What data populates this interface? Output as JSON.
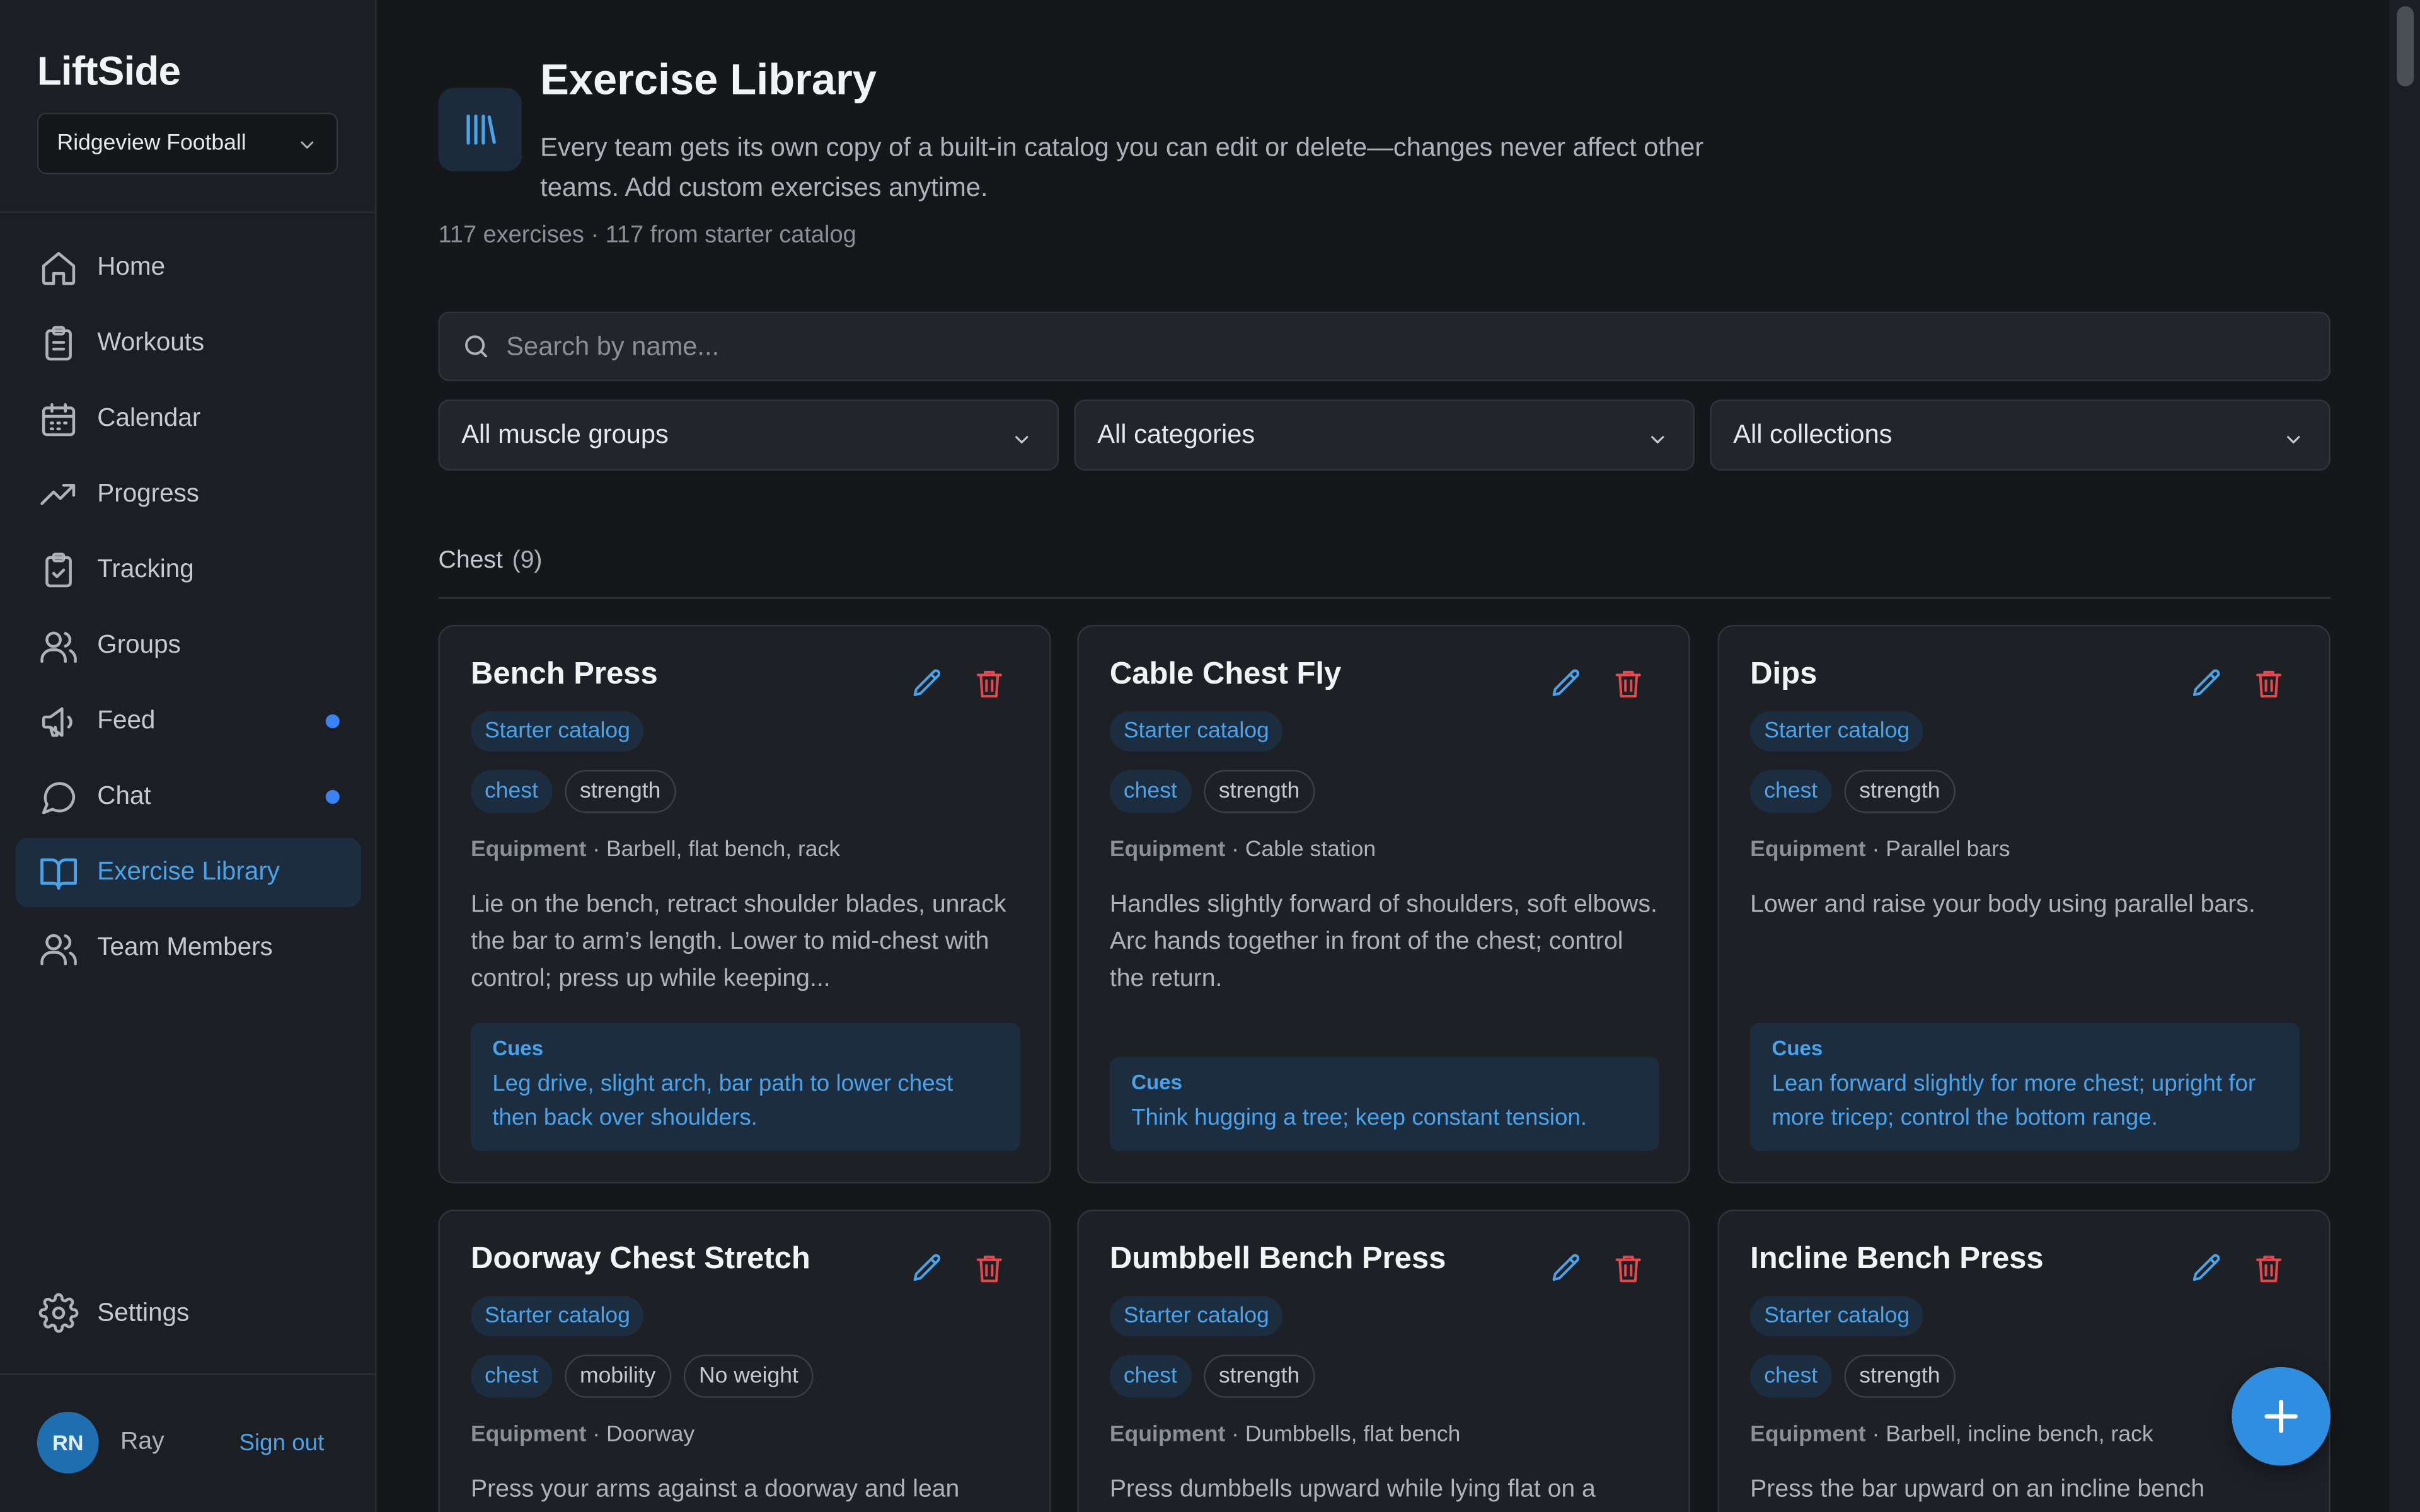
{
  "app": {
    "name": "LiftSide",
    "team": "Ridgeview Football"
  },
  "sidebar": {
    "items": [
      {
        "label": "Home",
        "icon": "home-icon"
      },
      {
        "label": "Workouts",
        "icon": "clipboard-list-icon"
      },
      {
        "label": "Calendar",
        "icon": "calendar-icon"
      },
      {
        "label": "Progress",
        "icon": "trending-up-icon"
      },
      {
        "label": "Tracking",
        "icon": "clipboard-check-icon"
      },
      {
        "label": "Groups",
        "icon": "users-icon"
      },
      {
        "label": "Feed",
        "icon": "megaphone-icon",
        "unread": true
      },
      {
        "label": "Chat",
        "icon": "message-circle-icon",
        "unread": true
      },
      {
        "label": "Exercise Library",
        "icon": "book-open-icon",
        "active": true
      },
      {
        "label": "Team Members",
        "icon": "users-icon"
      }
    ],
    "settings": "Settings",
    "user": {
      "initials": "RN",
      "name": "Ray"
    },
    "sign_out": "Sign out"
  },
  "page": {
    "title": "Exercise Library",
    "description": "Every team gets its own copy of a built-in catalog you can edit or delete—changes never affect other teams. Add custom exercises anytime.",
    "meta": "117 exercises · 117 from starter catalog"
  },
  "search": {
    "placeholder": "Search by name..."
  },
  "filters": {
    "muscle": "All muscle groups",
    "category": "All categories",
    "collection": "All collections"
  },
  "section": {
    "title": "Chest",
    "count": "(9)"
  },
  "equipment_label": "Equipment",
  "cues_label": "Cues",
  "cards": [
    {
      "title": "Bench Press",
      "source": "Starter catalog",
      "tags": [
        "chest",
        "strength"
      ],
      "equipment": "Barbell, flat bench, rack",
      "description": "Lie on the bench, retract shoulder blades, unrack the bar to arm’s length. Lower to mid-chest with control; press up while keeping...",
      "cues": "Leg drive, slight arch, bar path to lower chest then back over shoulders."
    },
    {
      "title": "Cable Chest Fly",
      "source": "Starter catalog",
      "tags": [
        "chest",
        "strength"
      ],
      "equipment": "Cable station",
      "description": "Handles slightly forward of shoulders, soft elbows. Arc hands together in front of the chest; control the return.",
      "cues": "Think hugging a tree; keep constant tension."
    },
    {
      "title": "Dips",
      "source": "Starter catalog",
      "tags": [
        "chest",
        "strength"
      ],
      "equipment": "Parallel bars",
      "description": "Lower and raise your body using parallel bars.",
      "cues": "Lean forward slightly for more chest; upright for more tricep; control the bottom range."
    },
    {
      "title": "Doorway Chest Stretch",
      "source": "Starter catalog",
      "tags": [
        "chest",
        "mobility",
        "No weight"
      ],
      "equipment": "Doorway",
      "description": "Press your arms against a doorway and lean"
    },
    {
      "title": "Dumbbell Bench Press",
      "source": "Starter catalog",
      "tags": [
        "chest",
        "strength"
      ],
      "equipment": "Dumbbells, flat bench",
      "description": "Press dumbbells upward while lying flat on a"
    },
    {
      "title": "Incline Bench Press",
      "source": "Starter catalog",
      "tags": [
        "chest",
        "strength"
      ],
      "equipment": "Barbell, incline bench, rack",
      "description": "Press the bar upward on an incline bench"
    }
  ],
  "colors": {
    "background": "#15171b",
    "sidebar": "#1b1e23",
    "accent": "#4aa3e8",
    "danger": "#e5484d",
    "fab": "#2f8ee0"
  }
}
